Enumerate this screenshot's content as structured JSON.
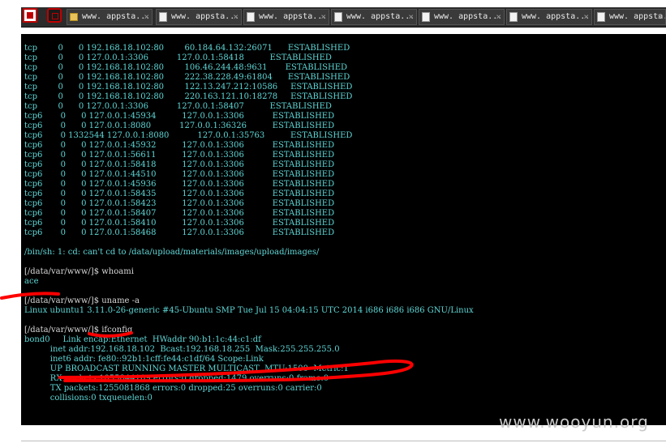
{
  "tabs": [
    {
      "label": "www. appsta...",
      "icon": "folder-icon"
    },
    {
      "label": "www. appsta...",
      "icon": "document-icon"
    },
    {
      "label": "www. appsta...",
      "icon": "document-icon"
    },
    {
      "label": "www. appsta...",
      "icon": "document-icon"
    },
    {
      "label": "www. appsta...",
      "icon": "document-icon"
    },
    {
      "label": "www. appsta...",
      "icon": "document-icon"
    },
    {
      "label": "www. appsta...",
      "icon": "document-icon"
    }
  ],
  "terminal": {
    "lines": [
      {
        "t": "tcp        0      0 192.168.18.102:80        60.184.64.132:26071      ESTABLISHED",
        "c": "cyan"
      },
      {
        "t": "tcp        0      0 127.0.0.1:3306           127.0.0.1:58418          ESTABLISHED",
        "c": "cyan"
      },
      {
        "t": "tcp        0      0 192.168.18.102:80        106.46.244.48:9631       ESTABLISHED",
        "c": "cyan"
      },
      {
        "t": "tcp        0      0 192.168.18.102:80        222.38.228.49:61804      ESTABLISHED",
        "c": "cyan"
      },
      {
        "t": "tcp        0      0 192.168.18.102:80        122.13.247.212:10586     ESTABLISHED",
        "c": "cyan"
      },
      {
        "t": "tcp        0      0 192.168.18.102:80        220.163.121.10:18278     ESTABLISHED",
        "c": "cyan"
      },
      {
        "t": "tcp        0      0 127.0.0.1:3306           127.0.0.1:58407          ESTABLISHED",
        "c": "cyan"
      },
      {
        "t": "tcp6       0      0 127.0.0.1:45934          127.0.0.1:3306           ESTABLISHED",
        "c": "cyan"
      },
      {
        "t": "tcp6       0      0 127.0.0.1:8080           127.0.0.1:36326          ESTABLISHED",
        "c": "cyan"
      },
      {
        "t": "tcp6       0 1332544 127.0.0.1:8080           127.0.0.1:35763          ESTABLISHED",
        "c": "cyan"
      },
      {
        "t": "tcp6       0      0 127.0.0.1:45932          127.0.0.1:3306           ESTABLISHED",
        "c": "cyan"
      },
      {
        "t": "tcp6       0      0 127.0.0.1:56611          127.0.0.1:3306           ESTABLISHED",
        "c": "cyan"
      },
      {
        "t": "tcp6       0      0 127.0.0.1:58418          127.0.0.1:3306           ESTABLISHED",
        "c": "cyan"
      },
      {
        "t": "tcp6       0      0 127.0.0.1:44510          127.0.0.1:3306           ESTABLISHED",
        "c": "cyan"
      },
      {
        "t": "tcp6       0      0 127.0.0.1:45936          127.0.0.1:3306           ESTABLISHED",
        "c": "cyan"
      },
      {
        "t": "tcp6       0      0 127.0.0.1:58435          127.0.0.1:3306           ESTABLISHED",
        "c": "cyan"
      },
      {
        "t": "tcp6       0      0 127.0.0.1:58423          127.0.0.1:3306           ESTABLISHED",
        "c": "cyan"
      },
      {
        "t": "tcp6       0      0 127.0.0.1:58407          127.0.0.1:3306           ESTABLISHED",
        "c": "cyan"
      },
      {
        "t": "tcp6       0      0 127.0.0.1:58410          127.0.0.1:3306           ESTABLISHED",
        "c": "cyan"
      },
      {
        "t": "tcp6       0      0 127.0.0.1:58468          127.0.0.1:3306           ESTABLISHED",
        "c": "cyan"
      },
      {
        "t": "",
        "c": "gray"
      },
      {
        "t": "/bin/sh: 1: cd: can't cd to /data/upload/materials/images/upload/images/",
        "c": "cyan"
      },
      {
        "t": "",
        "c": "gray"
      },
      {
        "t": "[/data/var/www/]$ whoami",
        "c": "gray"
      },
      {
        "t": "ace",
        "c": "cyan"
      },
      {
        "t": "",
        "c": "gray"
      },
      {
        "t": "[/data/var/www/]$ uname -a",
        "c": "gray"
      },
      {
        "t": "Linux ubuntu1 3.11.0-26-generic #45-Ubuntu SMP Tue Jul 15 04:04:15 UTC 2014 i686 i686 i686 GNU/Linux",
        "c": "cyan"
      },
      {
        "t": "",
        "c": "gray"
      },
      {
        "t": "[/data/var/www/]$ ifconfig",
        "c": "gray"
      },
      {
        "t": "bond0     Link encap:Ethernet  HWaddr 90:b1:1c:44:c1:df",
        "c": "cyan"
      },
      {
        "t": "          inet addr:192.168.18.102  Bcast:192.168.18.255  Mask:255.255.255.0",
        "c": "cyan"
      },
      {
        "t": "          inet6 addr: fe80::92b1:1cff:fe44:c1df/64 Scope:Link",
        "c": "cyan"
      },
      {
        "t": "          UP BROADCAST RUNNING MASTER MULTICAST  MTU:1500  Metric:1",
        "c": "cyan"
      },
      {
        "t": "          RX packets:1055844109 errors:0 dropped:1479 overruns:0 frame:0",
        "c": "cyan"
      },
      {
        "t": "          TX packets:1255081868 errors:0 dropped:25 overruns:0 carrier:0",
        "c": "cyan"
      },
      {
        "t": "          collisions:0 txqueuelen:0",
        "c": "cyan"
      }
    ]
  },
  "watermark": "www.wooyun.org",
  "colors": {
    "terminal_bg": "#000000",
    "output_text": "#5fd7d7",
    "prompt_text": "#d9d9d9",
    "annotation": "#ff0000"
  }
}
